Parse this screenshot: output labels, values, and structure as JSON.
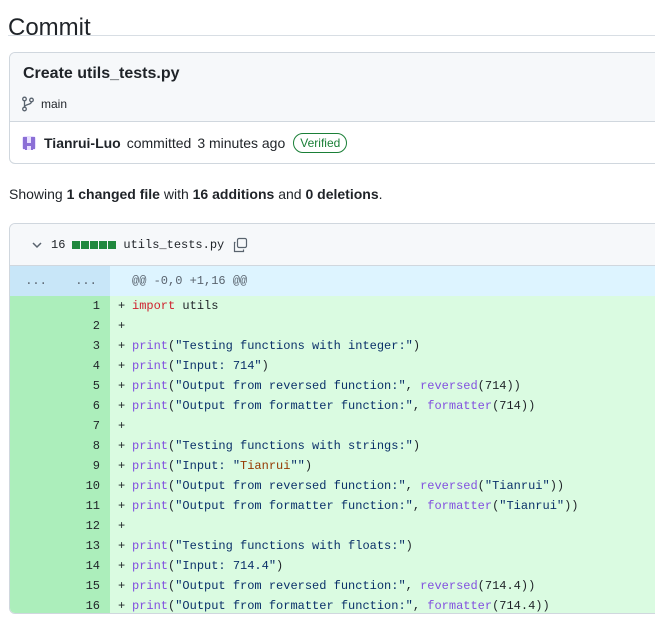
{
  "page": {
    "title": "Commit"
  },
  "commit": {
    "message": "Create utils_tests.py",
    "branch": "main",
    "author": "Tianrui-Luo",
    "action": "committed",
    "time": "3 minutes ago",
    "badge": "Verified"
  },
  "summary": {
    "prefix": "Showing ",
    "files": "1 changed file",
    "with": " with ",
    "additions": "16 additions",
    "and": " and ",
    "deletions": "0 deletions",
    "suffix": "."
  },
  "file": {
    "changes": "16",
    "name": "utils_tests.py",
    "hunk_left": "...",
    "hunk_right": "...",
    "hunk_header": "@@ -0,0 +1,16 @@"
  },
  "lines": [
    {
      "n": "1",
      "tokens": [
        [
          "kw",
          "import"
        ],
        [
          "",
          "utils"
        ]
      ]
    },
    {
      "n": "2",
      "tokens": []
    },
    {
      "n": "3",
      "tokens": [
        [
          "fn",
          "print"
        ],
        [
          "",
          "("
        ],
        [
          "str",
          "\"Testing functions with integer:\""
        ],
        [
          "",
          ")"
        ]
      ]
    },
    {
      "n": "4",
      "tokens": [
        [
          "fn",
          "print"
        ],
        [
          "",
          "("
        ],
        [
          "str",
          "\"Input: 714\""
        ],
        [
          "",
          ")"
        ]
      ]
    },
    {
      "n": "5",
      "tokens": [
        [
          "fn",
          "print"
        ],
        [
          "",
          "("
        ],
        [
          "str",
          "\"Output from reversed function:\""
        ],
        [
          "",
          ", "
        ],
        [
          "fn",
          "reversed"
        ],
        [
          "",
          "(714))"
        ]
      ]
    },
    {
      "n": "6",
      "tokens": [
        [
          "fn",
          "print"
        ],
        [
          "",
          "("
        ],
        [
          "str",
          "\"Output from formatter function:\""
        ],
        [
          "",
          ", "
        ],
        [
          "fn",
          "formatter"
        ],
        [
          "",
          "(714))"
        ]
      ]
    },
    {
      "n": "7",
      "tokens": []
    },
    {
      "n": "8",
      "tokens": [
        [
          "fn",
          "print"
        ],
        [
          "",
          "("
        ],
        [
          "str",
          "\"Testing functions with strings:\""
        ],
        [
          "",
          ")"
        ]
      ]
    },
    {
      "n": "9",
      "tokens": [
        [
          "fn",
          "print"
        ],
        [
          "",
          "("
        ],
        [
          "str",
          "\"Input: \""
        ],
        [
          "name",
          "Tianrui"
        ],
        [
          "str",
          "\"\""
        ],
        [
          "",
          ")"
        ]
      ]
    },
    {
      "n": "10",
      "tokens": [
        [
          "fn",
          "print"
        ],
        [
          "",
          "("
        ],
        [
          "str",
          "\"Output from reversed function:\""
        ],
        [
          "",
          ", "
        ],
        [
          "fn",
          "reversed"
        ],
        [
          "",
          "("
        ],
        [
          "str",
          "\"Tianrui\""
        ],
        [
          "",
          "))"
        ]
      ]
    },
    {
      "n": "11",
      "tokens": [
        [
          "fn",
          "print"
        ],
        [
          "",
          "("
        ],
        [
          "str",
          "\"Output from formatter function:\""
        ],
        [
          "",
          ", "
        ],
        [
          "fn",
          "formatter"
        ],
        [
          "",
          "("
        ],
        [
          "str",
          "\"Tianrui\""
        ],
        [
          "",
          "))"
        ]
      ]
    },
    {
      "n": "12",
      "tokens": []
    },
    {
      "n": "13",
      "tokens": [
        [
          "fn",
          "print"
        ],
        [
          "",
          "("
        ],
        [
          "str",
          "\"Testing functions with floats:\""
        ],
        [
          "",
          ")"
        ]
      ]
    },
    {
      "n": "14",
      "tokens": [
        [
          "fn",
          "print"
        ],
        [
          "",
          "("
        ],
        [
          "str",
          "\"Input: 714.4\""
        ],
        [
          "",
          ")"
        ]
      ]
    },
    {
      "n": "15",
      "tokens": [
        [
          "fn",
          "print"
        ],
        [
          "",
          "("
        ],
        [
          "str",
          "\"Output from reversed function:\""
        ],
        [
          "",
          ", "
        ],
        [
          "fn",
          "reversed"
        ],
        [
          "",
          "(714.4))"
        ]
      ]
    },
    {
      "n": "16",
      "tokens": [
        [
          "fn",
          "print"
        ],
        [
          "",
          "("
        ],
        [
          "str",
          "\"Output from formatter function:\""
        ],
        [
          "",
          ", "
        ],
        [
          "fn",
          "formatter"
        ],
        [
          "",
          "(714.4))"
        ]
      ]
    }
  ],
  "colors": {
    "addition_bg": "#dafbe1",
    "addition_gutter": "#aceebb",
    "hunk_bg": "#ddf4ff",
    "verified": "#1a7f37"
  },
  "icons": [
    "git-branch-icon",
    "chevron-down-icon",
    "copy-icon",
    "avatar"
  ]
}
